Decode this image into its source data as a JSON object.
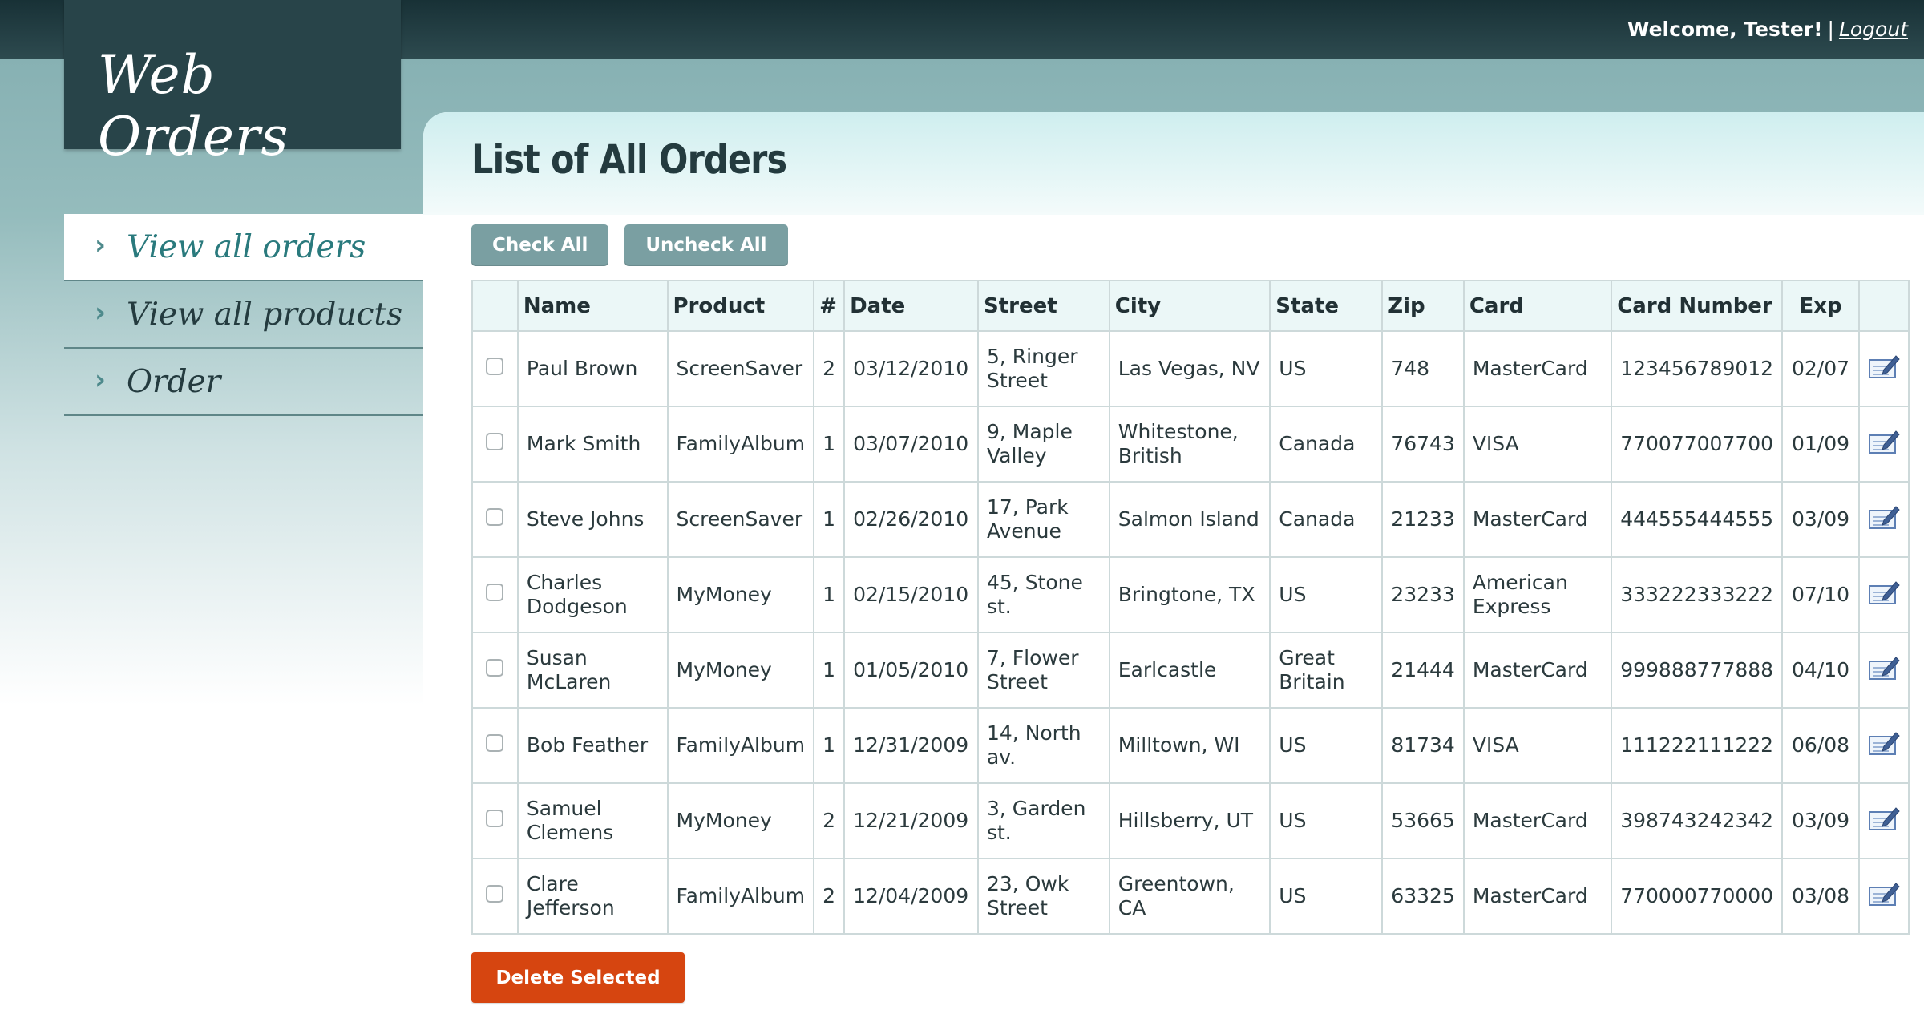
{
  "header": {
    "welcome_text": "Welcome, Tester!",
    "separator": "|",
    "logout_label": "Logout"
  },
  "logo": {
    "text": "Web Orders"
  },
  "nav": {
    "items": [
      {
        "label": "View all orders",
        "active": true
      },
      {
        "label": "View all products",
        "active": false
      },
      {
        "label": "Order",
        "active": false
      }
    ]
  },
  "page": {
    "title": "List of All Orders",
    "check_all_label": "Check All",
    "uncheck_all_label": "Uncheck All",
    "delete_label": "Delete Selected"
  },
  "table": {
    "columns": [
      "Name",
      "Product",
      "#",
      "Date",
      "Street",
      "City",
      "State",
      "Zip",
      "Card",
      "Card Number",
      "Exp"
    ],
    "rows": [
      [
        "Paul Brown",
        "ScreenSaver",
        "2",
        "03/12/2010",
        "5, Ringer Street",
        "Las Vegas, NV",
        "US",
        "748",
        "MasterCard",
        "123456789012",
        "02/07"
      ],
      [
        "Mark Smith",
        "FamilyAlbum",
        "1",
        "03/07/2010",
        "9, Maple Valley",
        "Whitestone, British",
        "Canada",
        "76743",
        "VISA",
        "770077007700",
        "01/09"
      ],
      [
        "Steve Johns",
        "ScreenSaver",
        "1",
        "02/26/2010",
        "17, Park Avenue",
        "Salmon Island",
        "Canada",
        "21233",
        "MasterCard",
        "444555444555",
        "03/09"
      ],
      [
        "Charles Dodgeson",
        "MyMoney",
        "1",
        "02/15/2010",
        "45, Stone st.",
        "Bringtone, TX",
        "US",
        "23233",
        "American Express",
        "333222333222",
        "07/10"
      ],
      [
        "Susan McLaren",
        "MyMoney",
        "1",
        "01/05/2010",
        "7, Flower Street",
        "Earlcastle",
        "Great Britain",
        "21444",
        "MasterCard",
        "999888777888",
        "04/10"
      ],
      [
        "Bob Feather",
        "FamilyAlbum",
        "1",
        "12/31/2009",
        "14, North av.",
        "Milltown, WI",
        "US",
        "81734",
        "VISA",
        "111222111222",
        "06/08"
      ],
      [
        "Samuel Clemens",
        "MyMoney",
        "2",
        "12/21/2009",
        "3, Garden st.",
        "Hillsberry, UT",
        "US",
        "53665",
        "MasterCard",
        "398743242342",
        "03/09"
      ],
      [
        "Clare Jefferson",
        "FamilyAlbum",
        "2",
        "12/04/2009",
        "23, Owk Street",
        "Greentown, CA",
        "US",
        "63325",
        "MasterCard",
        "770000770000",
        "03/08"
      ]
    ],
    "row_icon": "edit-icon"
  },
  "colors": {
    "topbar": "#1f3a3f",
    "accent": "#2a7a7d",
    "button_gray": "#7a9fa2",
    "delete_button": "#d64510"
  }
}
